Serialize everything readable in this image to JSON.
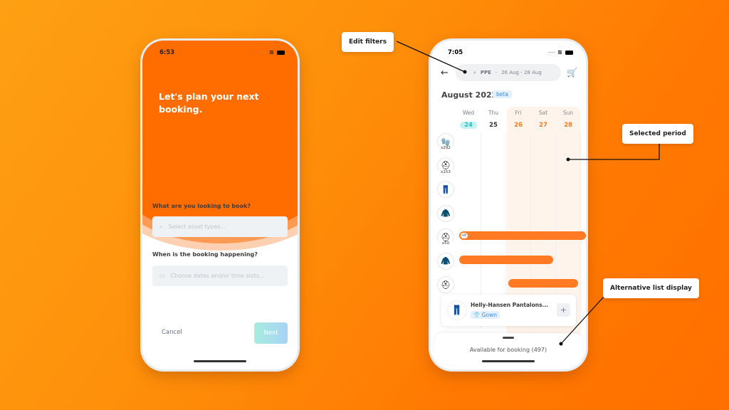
{
  "phone_left": {
    "status_time": "6:53",
    "hero_title": "Let's plan your next booking.",
    "question_asset": "What are you looking to book?",
    "asset_placeholder": "Select asset types...",
    "question_date": "When is the booking happening?",
    "date_placeholder": "Choose dates and/or time slots...",
    "cancel_label": "Cancel",
    "next_label": "Next",
    "brand_color": "#ff6d00"
  },
  "phone_right": {
    "status_time": "7:05",
    "search": {
      "category": "PPE",
      "separator": "·",
      "dates": "26 Aug - 28 Aug"
    },
    "month_title": "August 2022",
    "beta_badge": "beta",
    "days": [
      {
        "name": "Wed",
        "date": "24",
        "state": "today"
      },
      {
        "name": "Thu",
        "date": "25",
        "state": "normal"
      },
      {
        "name": "Fri",
        "date": "26",
        "state": "selected"
      },
      {
        "name": "Sat",
        "date": "27",
        "state": "selected"
      },
      {
        "name": "Sun",
        "date": "28",
        "state": "selected"
      }
    ],
    "assets": [
      {
        "icon": "gloves-icon",
        "glyph": "🧤",
        "count": "x292"
      },
      {
        "icon": "hard-hat-white-icon",
        "glyph": "⛑",
        "count": "x153"
      },
      {
        "icon": "overalls-icon",
        "glyph": "👖",
        "count": ""
      },
      {
        "icon": "hi-vis-jacket-icon",
        "glyph": "🧥",
        "count": ""
      },
      {
        "icon": "hard-hat-yellow-icon",
        "glyph": "⛑",
        "count": "x50",
        "bar_tag": "x8"
      },
      {
        "icon": "hi-vis-coat-icon",
        "glyph": "🧥",
        "count": ""
      },
      {
        "icon": "hard-hat-light-icon",
        "glyph": "⛑",
        "count": ""
      }
    ],
    "card": {
      "name": "Helly-Hansen Pantalons...",
      "tag": "Gown",
      "add_label": "+"
    },
    "available_label": "Available for booking (497)"
  },
  "callouts": {
    "edit_filters": "Edit filters",
    "selected_period": "Selected period",
    "alternative_list": "Alternative list display"
  }
}
